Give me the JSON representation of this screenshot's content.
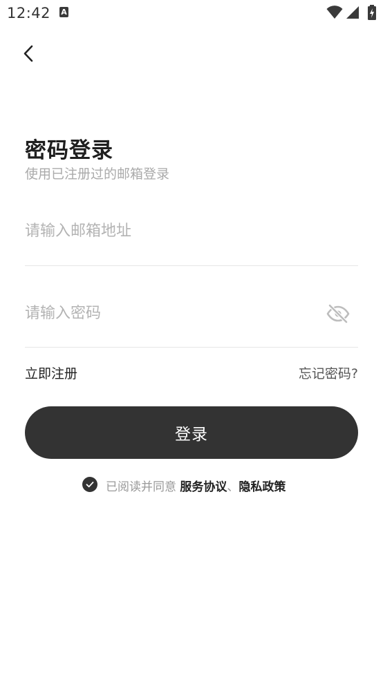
{
  "status_bar": {
    "time": "12:42",
    "notification_letter": "A"
  },
  "header": {
    "back_icon": "chevron-left-icon"
  },
  "page": {
    "title": "密码登录",
    "subtitle": "使用已注册过的邮箱登录"
  },
  "form": {
    "email_placeholder": "请输入邮箱地址",
    "email_value": "",
    "password_placeholder": "请输入密码",
    "password_value": "",
    "password_toggle_icon": "eye-off-icon"
  },
  "links": {
    "register": "立即注册",
    "forgot_password": "忘记密码?"
  },
  "login_button": {
    "label": "登录"
  },
  "agreement": {
    "checked": true,
    "prefix": "已阅读并同意",
    "service_agreement": "服务协议",
    "separator": "、",
    "privacy_policy": "隐私政策"
  },
  "colors": {
    "primary_button": "#333333",
    "placeholder": "#b3b3b3",
    "divider": "#e6e6e6",
    "muted_text": "#999999"
  }
}
